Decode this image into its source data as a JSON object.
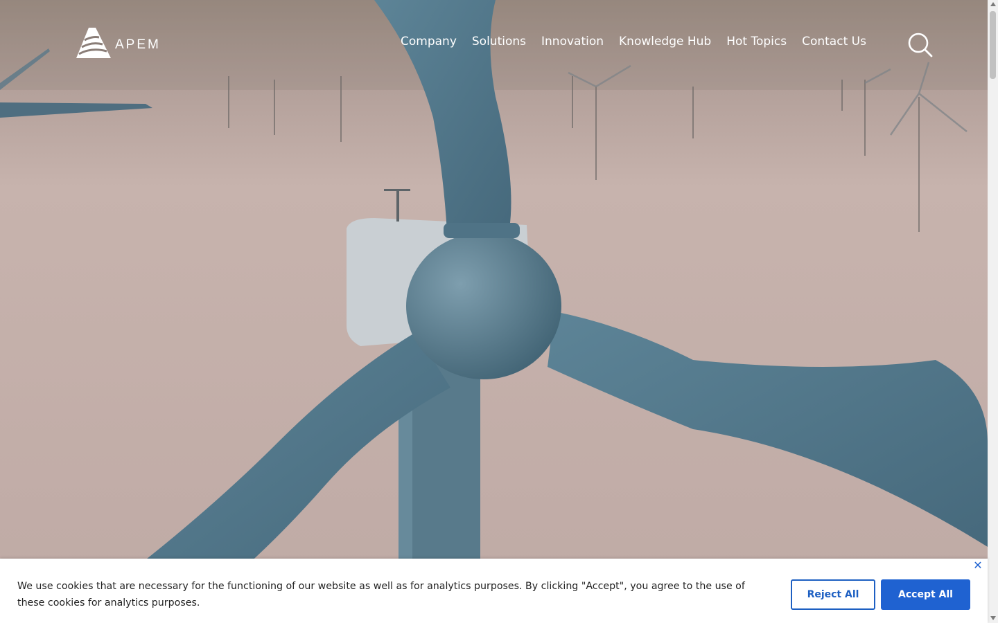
{
  "brand": {
    "name": "APEM"
  },
  "nav": {
    "items": [
      {
        "label": "Company"
      },
      {
        "label": "Solutions"
      },
      {
        "label": "Innovation"
      },
      {
        "label": "Knowledge Hub"
      },
      {
        "label": "Hot Topics"
      },
      {
        "label": "Contact Us"
      }
    ],
    "search_icon": "search-icon"
  },
  "hero": {
    "media": "offshore wind turbine video background",
    "colors": {
      "sky": "#b9a39b",
      "sea": "#c9b3ac",
      "turbine": "#4f7386",
      "nacelle": "#c8cfd4"
    }
  },
  "cookie_banner": {
    "text": "We use cookies that are necessary for the functioning of our website as well as for analytics purposes. By clicking \"Accept\", you agree to the use of these cookies for analytics purposes.",
    "reject_label": "Reject All",
    "accept_label": "Accept All",
    "close_icon": "close-icon",
    "colors": {
      "accent": "#1f62d1"
    }
  }
}
